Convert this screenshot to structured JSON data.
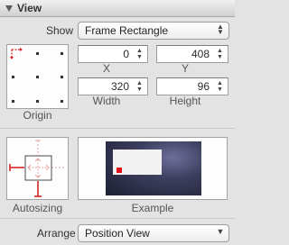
{
  "header": {
    "title": "View"
  },
  "show": {
    "label": "Show",
    "value": "Frame Rectangle"
  },
  "fields": {
    "x": {
      "value": "0",
      "label": "X"
    },
    "y": {
      "value": "408",
      "label": "Y"
    },
    "width": {
      "value": "320",
      "label": "Width"
    },
    "height": {
      "value": "96",
      "label": "Height"
    }
  },
  "origin": {
    "label": "Origin"
  },
  "autosizing": {
    "label": "Autosizing"
  },
  "example": {
    "label": "Example"
  },
  "arrange": {
    "label": "Arrange",
    "value": "Position View"
  },
  "colors": {
    "strut": "#d62424",
    "accent_red": "#e0101a"
  }
}
